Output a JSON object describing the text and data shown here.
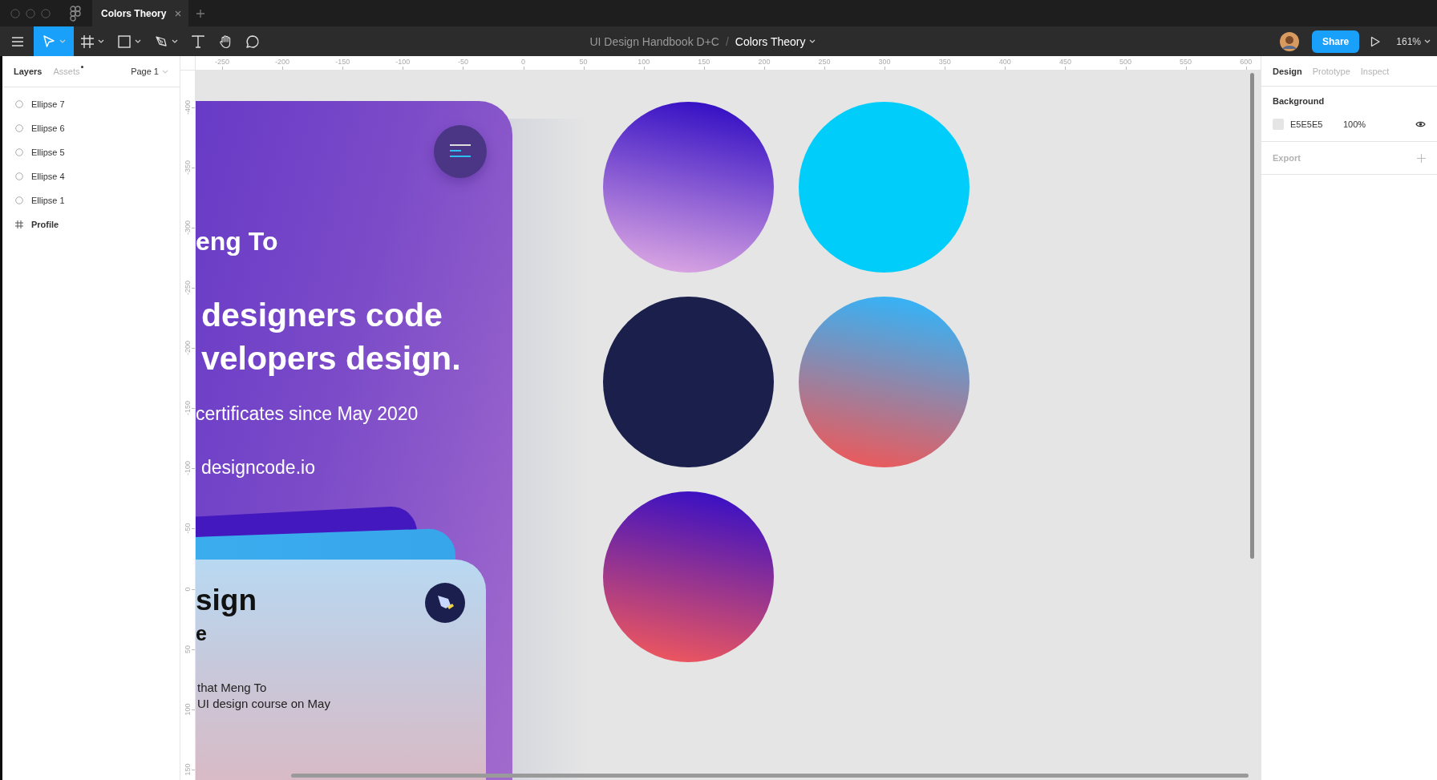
{
  "window": {
    "tab_title": "Colors Theory"
  },
  "toolbar": {
    "tools": [
      {
        "kind": "move",
        "selected": true
      },
      {
        "kind": "frame",
        "selected": false
      },
      {
        "kind": "shape",
        "selected": false
      },
      {
        "kind": "pen",
        "selected": false
      },
      {
        "kind": "text",
        "selected": false
      },
      {
        "kind": "hand",
        "selected": false
      },
      {
        "kind": "comment",
        "selected": false
      }
    ],
    "file_name": "UI Design Handbook D+C",
    "separator": "/",
    "page_title": "Colors Theory",
    "share": "Share",
    "zoom": "161%"
  },
  "left_panel": {
    "tabs": [
      {
        "label": "Layers",
        "selected": true,
        "has_update": false
      },
      {
        "label": "Assets",
        "selected": false,
        "has_update": true
      }
    ],
    "page": "Page 1",
    "layers": [
      {
        "name": "Ellipse 7",
        "kind": "ellipse"
      },
      {
        "name": "Ellipse 6",
        "kind": "ellipse"
      },
      {
        "name": "Ellipse 5",
        "kind": "ellipse"
      },
      {
        "name": "Ellipse 4",
        "kind": "ellipse"
      },
      {
        "name": "Ellipse 1",
        "kind": "ellipse"
      },
      {
        "name": "Profile",
        "kind": "frame"
      }
    ]
  },
  "rulers": {
    "horizontal": [
      "-250",
      "-200",
      "-150",
      "-100",
      "-50",
      "0",
      "50",
      "100",
      "150",
      "200",
      "250",
      "300",
      "350",
      "400",
      "450",
      "500",
      "550",
      "600"
    ],
    "vertical": [
      "-400",
      "-350",
      "-300",
      "-250",
      "-200",
      "-150",
      "-100",
      "-50",
      "0",
      "50",
      "100",
      "150"
    ]
  },
  "canvas": {
    "profile_card": {
      "name": "eng To",
      "headline": [
        "designers code",
        "velopers design."
      ],
      "subtitle": "certificates since May 2020",
      "link": "designcode.io"
    },
    "course_card": {
      "title": "sign",
      "subtitle": "e",
      "body": [
        "that Meng To",
        "UI design course on May"
      ]
    }
  },
  "right_panel": {
    "tabs": [
      {
        "label": "Design",
        "selected": true
      },
      {
        "label": "Prototype",
        "selected": false
      },
      {
        "label": "Inspect",
        "selected": false
      }
    ],
    "background": {
      "label": "Background",
      "hex": "E5E5E5",
      "opacity": "100%",
      "visible": true
    },
    "export": {
      "label": "Export"
    }
  }
}
